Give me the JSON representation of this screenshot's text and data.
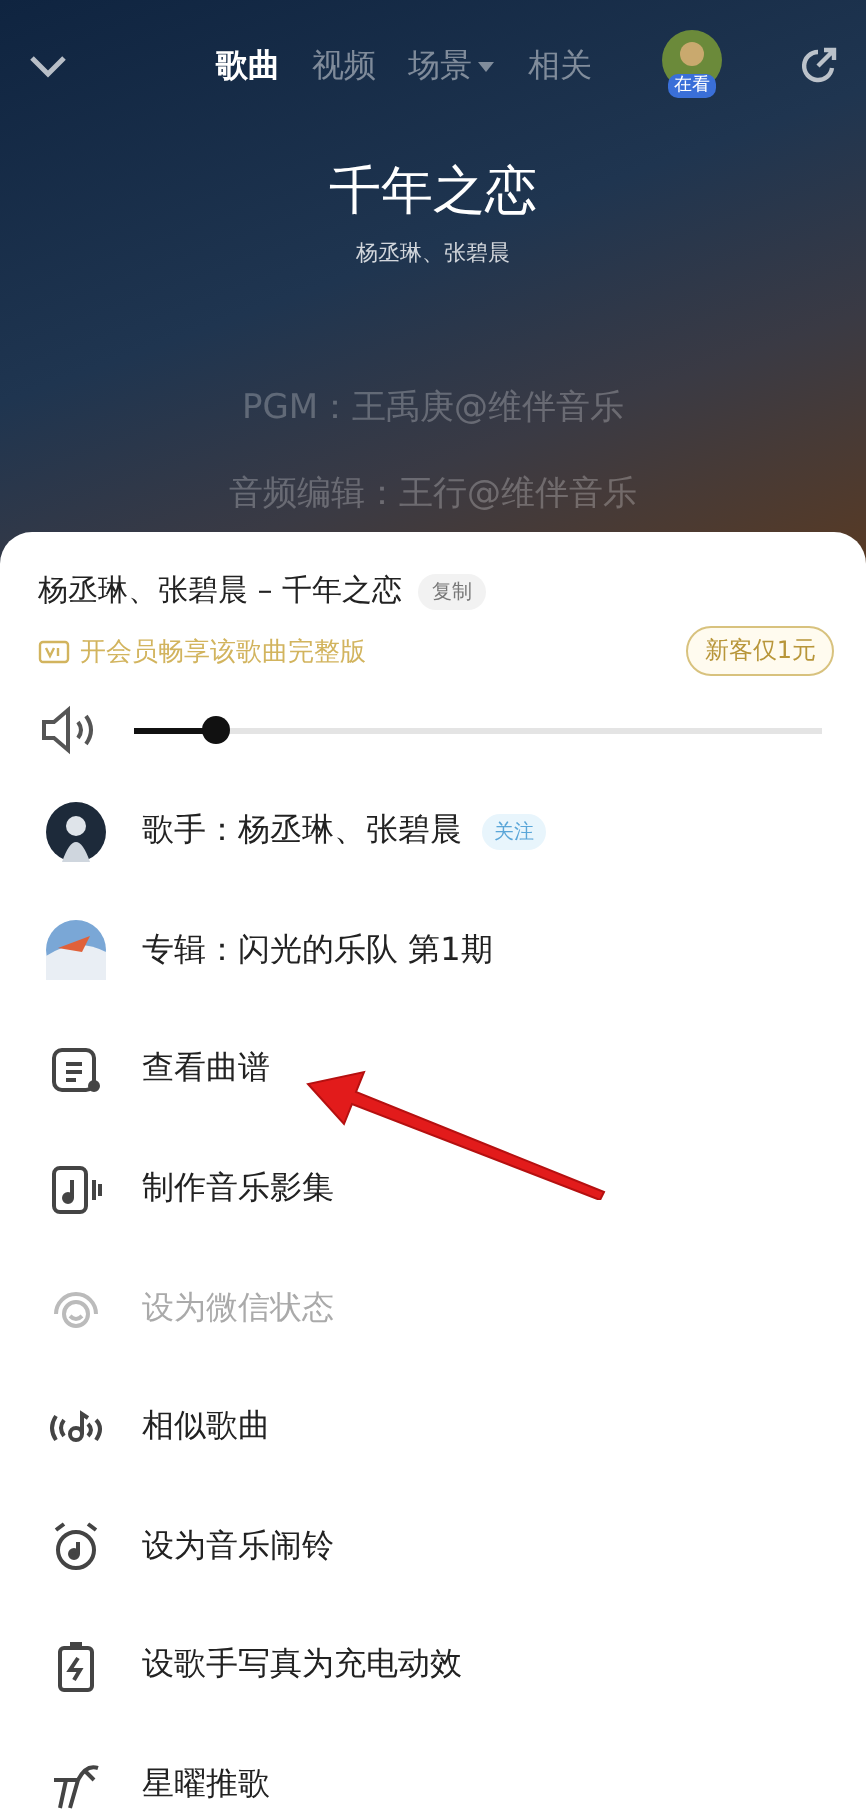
{
  "header": {
    "tabs": [
      {
        "label": "歌曲",
        "selected": true,
        "dropdown": false
      },
      {
        "label": "视频",
        "selected": false,
        "dropdown": false
      },
      {
        "label": "场景",
        "selected": false,
        "dropdown": true
      },
      {
        "label": "相关",
        "selected": false,
        "dropdown": false
      }
    ],
    "avatar_badge": "在看"
  },
  "song": {
    "title": "千年之恋",
    "artists": "杨丞琳、张碧晨"
  },
  "lyrics": [
    "PGM：王禹庚@维伴音乐",
    "音频编辑：王行@维伴音乐"
  ],
  "sheet": {
    "song_line": "杨丞琳、张碧晨 – 千年之恋",
    "copy_button": "复制",
    "vip_text": "开会员畅享该歌曲完整版",
    "vip_button": "新客仅1元",
    "volume": {
      "level": 0.12
    },
    "items": [
      {
        "kind": "singer",
        "label": "歌手：杨丞琳、张碧晨",
        "tag": "关注",
        "disabled": false
      },
      {
        "kind": "album",
        "label": "专辑：闪光的乐队 第1期",
        "disabled": false
      },
      {
        "kind": "score",
        "label": "查看曲谱",
        "disabled": false
      },
      {
        "kind": "video",
        "label": "制作音乐影集",
        "disabled": false
      },
      {
        "kind": "status",
        "label": "设为微信状态",
        "disabled": true
      },
      {
        "kind": "similar",
        "label": "相似歌曲",
        "disabled": false
      },
      {
        "kind": "alarm",
        "label": "设为音乐闹铃",
        "disabled": false
      },
      {
        "kind": "charge",
        "label": "设歌手写真为充电动效",
        "disabled": false
      },
      {
        "kind": "star",
        "label": "星曜推歌",
        "disabled": false
      }
    ]
  }
}
